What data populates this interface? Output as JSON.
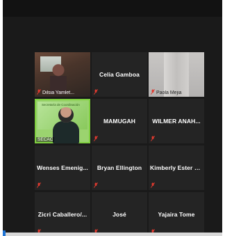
{
  "participants": [
    {
      "name": "",
      "mic_label": "Dilsia Yamlet...",
      "muted": true
    },
    {
      "name": "Celia Gamboa",
      "mic_label": "",
      "muted": true
    },
    {
      "name": "",
      "mic_label": "Paola Mejia",
      "muted": true
    },
    {
      "name": "",
      "mic_label": "SECAC",
      "muted": false
    },
    {
      "name": "MAMUGAH",
      "mic_label": "",
      "muted": true
    },
    {
      "name": "WILMER ANAH...",
      "mic_label": "",
      "muted": true
    },
    {
      "name": "Wenses  Emenig...",
      "mic_label": "",
      "muted": true
    },
    {
      "name": "Bryan Ellington",
      "mic_label": "",
      "muted": true
    },
    {
      "name": "Kimberly Ester B...",
      "mic_label": "",
      "muted": true
    },
    {
      "name": "Zicri  Caballero/...",
      "mic_label": "",
      "muted": true
    },
    {
      "name": "José",
      "mic_label": "",
      "muted": true
    },
    {
      "name": "Yajaira Tome",
      "mic_label": "",
      "muted": true
    }
  ],
  "video_logo_text": "Secretaría de Coordinación",
  "colors": {
    "muted_mic": "#e03a2f",
    "active_border": "#7fcf3f",
    "tile_bg": "#242424"
  }
}
